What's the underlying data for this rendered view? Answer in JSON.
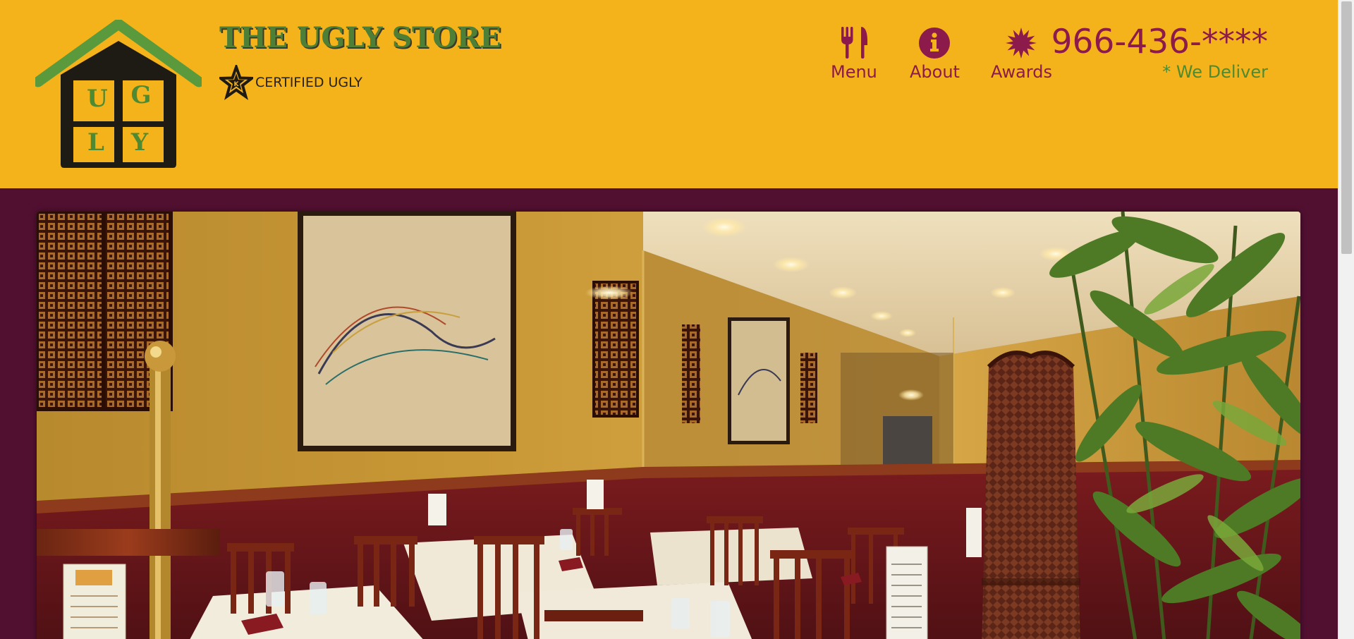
{
  "brand": {
    "title": "THE UGLY STORE",
    "badge_text": "CERTIFIED UGLY",
    "logo_letters": [
      "U",
      "G",
      "L",
      "Y"
    ]
  },
  "nav": {
    "items": [
      {
        "label": "Menu",
        "icon": "fork-knife-icon"
      },
      {
        "label": "About",
        "icon": "info-icon"
      },
      {
        "label": "Awards",
        "icon": "award-burst-icon"
      }
    ]
  },
  "contact": {
    "phone": "966-436-****",
    "delivery_note": "* We Deliver"
  },
  "hero": {
    "image_alt": "restaurant-dining-room-photo"
  },
  "colors": {
    "header_background": "#f5b31b",
    "page_background": "#521031",
    "nav_accent": "#8c1a4a",
    "brand_green": "#4e7f36",
    "delivery_green": "#4e8a32"
  }
}
